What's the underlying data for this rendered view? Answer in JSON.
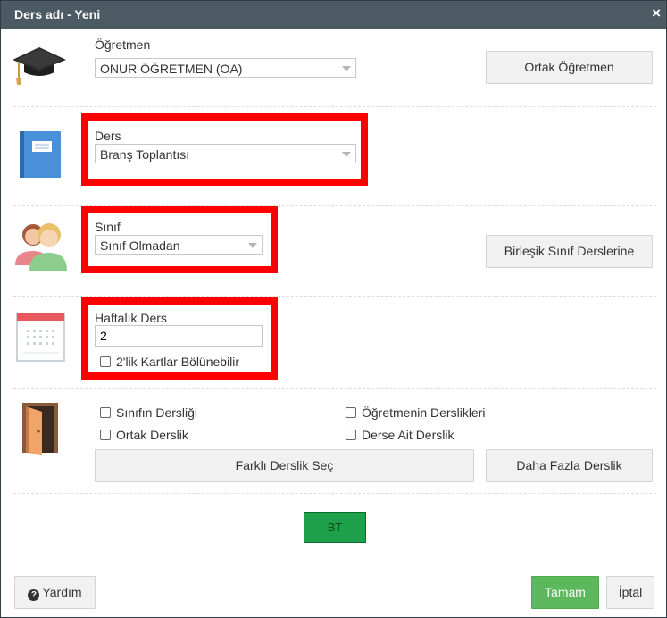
{
  "dialog": {
    "title": "Ders adı - Yeni",
    "close_icon": "×"
  },
  "teacher": {
    "label": "Öğretmen",
    "selected": "ONUR ÖĞRETMEN (OA)",
    "button": "Ortak Öğretmen"
  },
  "lesson": {
    "label": "Ders",
    "selected": "Branş Toplantısı"
  },
  "class": {
    "label": "Sınıf",
    "selected": "Sınıf Olmadan",
    "button": "Birleşik Sınıf Derslerine"
  },
  "weekly": {
    "label": "Haftalık Ders",
    "value": "2",
    "checkbox": "2'lik Kartlar Bölünebilir"
  },
  "rooms": {
    "checkboxes": [
      "Sınıfın Dersliği",
      "Öğretmenin Derslikleri",
      "Ortak Derslik",
      "Derse Ait Derslik"
    ],
    "select_button": "Farklı Derslik Seç",
    "more_button": "Daha Fazla Derslik"
  },
  "bt_button": "BT",
  "footer": {
    "help": "Yardım",
    "help_icon": "?",
    "ok": "Tamam",
    "cancel": "İptal"
  },
  "colors": {
    "titlebar": "#4b5a63",
    "highlight": "#ff0000",
    "ok_button": "#5cb85c",
    "bt_button": "#1ea04a"
  }
}
